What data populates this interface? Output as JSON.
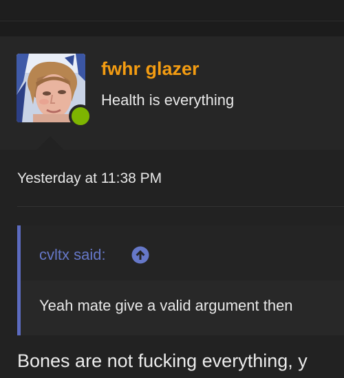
{
  "author": {
    "username": "fwhr glazer",
    "user_title": "Health is everything",
    "avatar_icon": "user-avatar-photo",
    "online_status": "online",
    "colors": {
      "username": "#f39c12",
      "online": "#7eb501"
    }
  },
  "post": {
    "timestamp": "Yesterday at 11:38 PM",
    "quote": {
      "author_label": "cvltx said:",
      "goto_icon": "arrow-up-circle-icon",
      "text": "Yeah mate give a valid argument then"
    },
    "message": "Bones are not fucking everything, y"
  },
  "theme": {
    "accent": "#5c6bc0",
    "background": "#1c1c1c"
  }
}
